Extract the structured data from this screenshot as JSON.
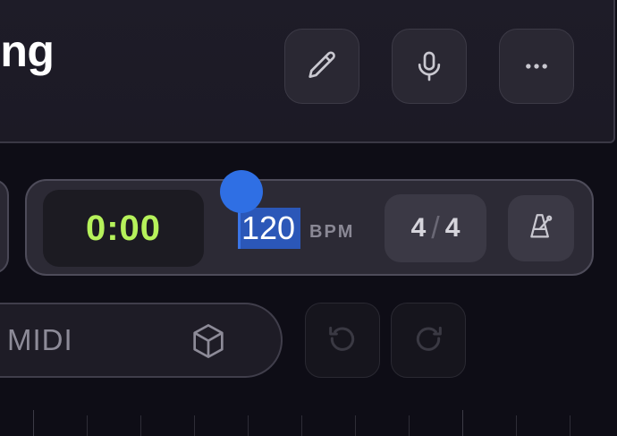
{
  "header": {
    "title": "rding",
    "buttons": [
      {
        "name": "edit",
        "icon": "pencil-icon"
      },
      {
        "name": "record",
        "icon": "microphone-icon"
      },
      {
        "name": "more",
        "icon": "more-horizontal-icon"
      }
    ]
  },
  "transport": {
    "time": "0:00",
    "tempo": "120",
    "tempo_unit": "BPM",
    "time_signature": {
      "numerator": "4",
      "denominator": "4"
    },
    "metronome_icon": "metronome-icon"
  },
  "toolbar": {
    "midi_label": "MIDI",
    "cube_icon": "cube-icon",
    "undo_icon": "undo-icon",
    "redo_icon": "redo-icon"
  },
  "colors": {
    "background": "#0e0d16",
    "time_display": "#b6f25b",
    "selection": "#2b57b8",
    "selection_handle": "#2f6fe4"
  }
}
